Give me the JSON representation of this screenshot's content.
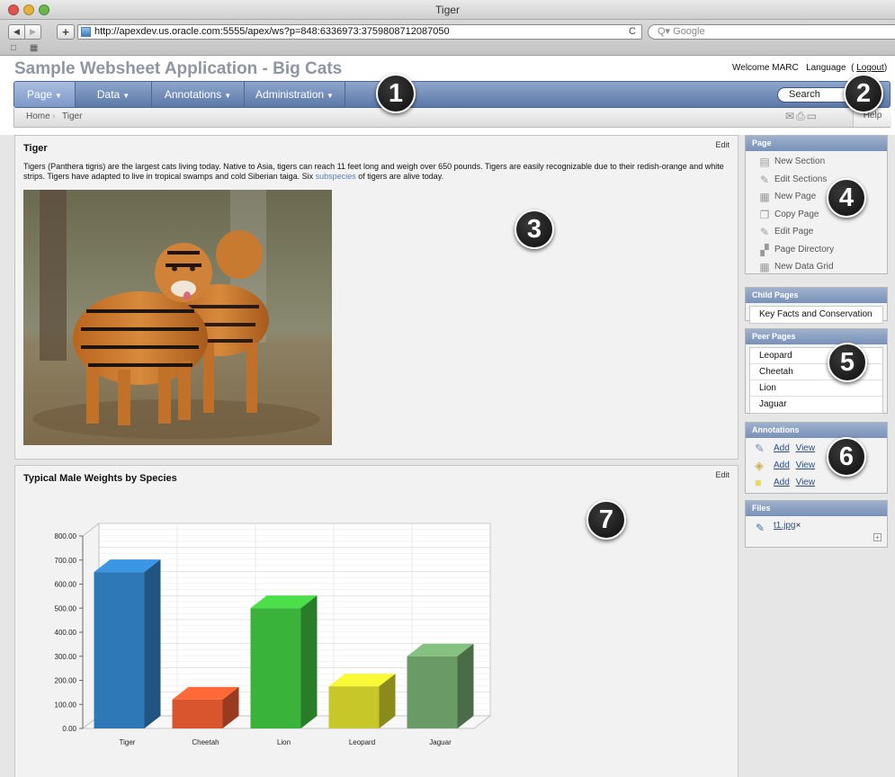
{
  "window": {
    "title": "Tiger"
  },
  "browser": {
    "url": "http://apexdev.us.oracle.com:5555/apex/ws?p=848:6336973:3759808712087050",
    "search_placeholder": "Q▾ Google"
  },
  "app": {
    "title": "Sample Websheet Application - Big Cats"
  },
  "user": {
    "welcome": "Welcome MARC",
    "language": "Language",
    "logout": "Logout"
  },
  "menu": {
    "items": [
      {
        "label": "Page"
      },
      {
        "label": "Data"
      },
      {
        "label": "Annotations"
      },
      {
        "label": "Administration"
      }
    ],
    "search_placeholder": "Search"
  },
  "breadcrumb": {
    "home": "Home",
    "current": "Tiger",
    "help": "Help"
  },
  "tiger_section": {
    "title": "Tiger",
    "edit": "Edit",
    "text_before": "Tigers (Panthera tigris) are the largest cats living today.  Native to Asia, tigers can reach 11 feet long and weigh over 650 pounds.   Tigers are easily recognizable due to their redish-orange and white strips.   Tigers have adapted to live in tropical swamps and cold Siberian taiga.   Six ",
    "link": "subspecies",
    "text_after": " of tigers are alive today."
  },
  "chart_section": {
    "title": "Typical Male Weights by Species",
    "edit": "Edit"
  },
  "chart_data": {
    "type": "bar",
    "categories": [
      "Tiger",
      "Cheetah",
      "Lion",
      "Leopard",
      "Jaguar"
    ],
    "values": [
      650,
      120,
      500,
      175,
      300
    ],
    "colors": [
      "#2f78b8",
      "#d9552d",
      "#3ab33a",
      "#c7c72a",
      "#6a9a66"
    ],
    "ylim": [
      0,
      800
    ],
    "yticks": [
      "0.00",
      "100.00",
      "200.00",
      "300.00",
      "400.00",
      "500.00",
      "600.00",
      "700.00",
      "800.00"
    ],
    "title": "",
    "xlabel": "",
    "ylabel": ""
  },
  "sidebar": {
    "page": {
      "title": "Page",
      "items": [
        {
          "label": "New Section",
          "icon": "new-section-icon"
        },
        {
          "label": "Edit Sections",
          "icon": "edit-sections-icon"
        },
        {
          "label": "New Page",
          "icon": "new-page-icon"
        },
        {
          "label": "Copy Page",
          "icon": "copy-page-icon"
        },
        {
          "label": "Edit Page",
          "icon": "edit-page-icon"
        },
        {
          "label": "Page Directory",
          "icon": "page-directory-icon"
        },
        {
          "label": "New Data Grid",
          "icon": "new-data-grid-icon"
        }
      ]
    },
    "child_pages": {
      "title": "Child Pages",
      "items": [
        "Key Facts and Conservation"
      ]
    },
    "peer_pages": {
      "title": "Peer Pages",
      "items": [
        "Leopard",
        "Cheetah",
        "Lion",
        "Jaguar"
      ]
    },
    "annotations": {
      "title": "Annotations",
      "rows": [
        {
          "add": "Add",
          "view": "View",
          "icon": "note-icon"
        },
        {
          "add": "Add",
          "view": "View",
          "icon": "tag-icon"
        },
        {
          "add": "Add",
          "view": "View",
          "icon": "sticky-note-icon"
        }
      ]
    },
    "files": {
      "title": "Files",
      "items": [
        {
          "name": "t1.jpg",
          "remove": "×"
        }
      ]
    }
  },
  "callouts": [
    "1",
    "2",
    "3",
    "4",
    "5",
    "6",
    "7"
  ]
}
